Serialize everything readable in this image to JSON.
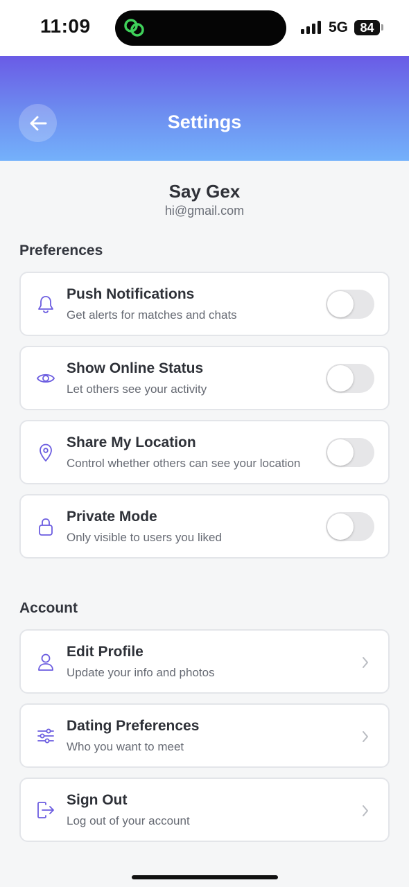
{
  "status_bar": {
    "time": "11:09",
    "network": "5G",
    "battery": "84"
  },
  "header": {
    "title": "Settings",
    "gradient": [
      "#6a5be6",
      "#74b1fb"
    ]
  },
  "profile": {
    "name": "Say Gex",
    "email": "hi@gmail.com"
  },
  "preferences": {
    "title": "Preferences",
    "items": [
      {
        "icon": "bell-icon",
        "title": "Push Notifications",
        "subtitle": "Get alerts for matches and chats",
        "enabled": false
      },
      {
        "icon": "eye-icon",
        "title": "Show Online Status",
        "subtitle": "Let others see your activity",
        "enabled": false
      },
      {
        "icon": "location-pin-icon",
        "title": "Share My Location",
        "subtitle": "Control whether others can see your location",
        "enabled": false
      },
      {
        "icon": "lock-icon",
        "title": "Private Mode",
        "subtitle": "Only visible to users you liked",
        "enabled": false
      }
    ]
  },
  "account": {
    "title": "Account",
    "items": [
      {
        "icon": "user-icon",
        "title": "Edit Profile",
        "subtitle": "Update your info and photos"
      },
      {
        "icon": "sliders-icon",
        "title": "Dating Preferences",
        "subtitle": "Who you want to meet"
      },
      {
        "icon": "sign-out-icon",
        "title": "Sign Out",
        "subtitle": "Log out of your account"
      }
    ]
  },
  "colors": {
    "accent_icon": "#6b5ce0",
    "card_border": "#e3e5e9",
    "toggle_off": "#e6e6e8"
  }
}
